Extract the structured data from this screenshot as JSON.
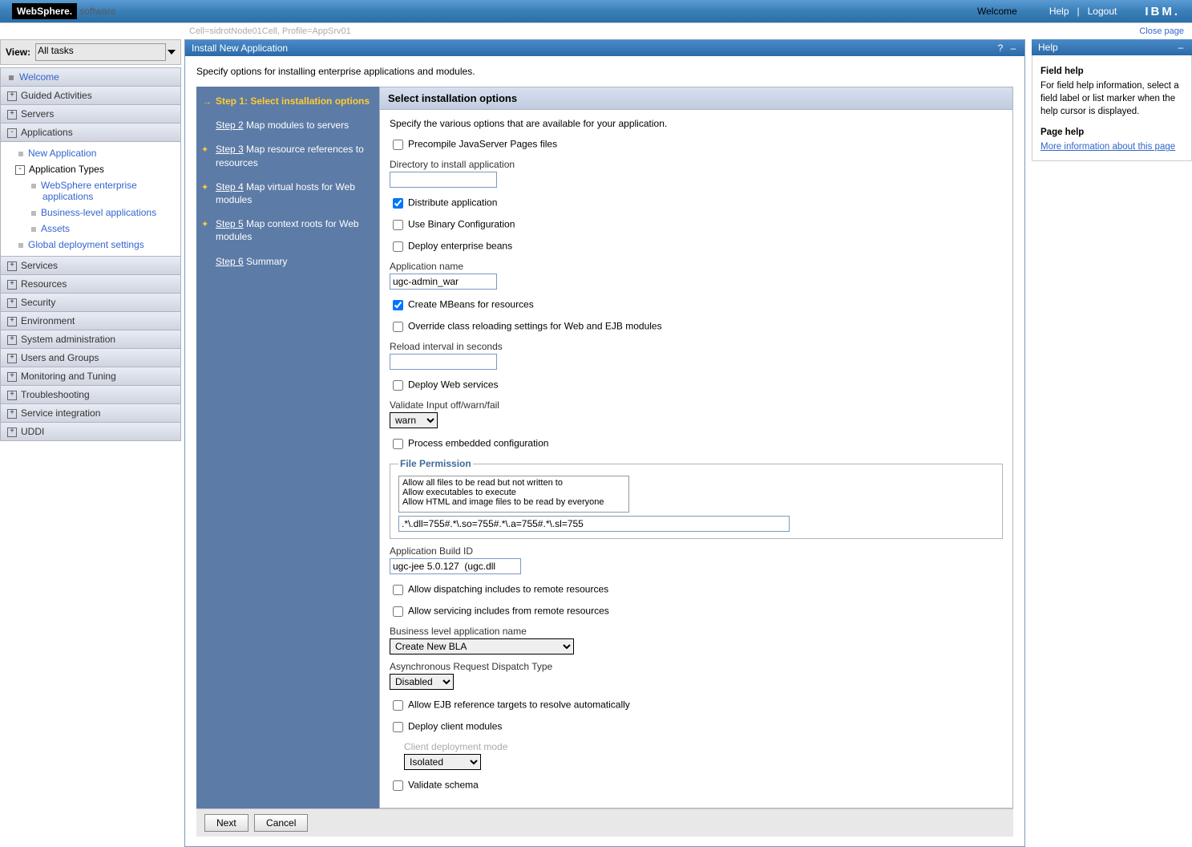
{
  "header": {
    "logo_main": "WebSphere.",
    "logo_sub": "software",
    "welcome": "Welcome",
    "help": "Help",
    "logout": "Logout",
    "ibm": "IBM.",
    "cell_info": "Cell=sidrotNode01Cell, Profile=AppSrv01",
    "close": "Close page"
  },
  "sidebar": {
    "view_label": "View:",
    "view_value": "All tasks",
    "welcome": "Welcome",
    "guided": "Guided Activities",
    "servers": "Servers",
    "applications": "Applications",
    "new_app": "New Application",
    "app_types": "Application Types",
    "ws_apps": "WebSphere enterprise applications",
    "biz_apps": "Business-level applications",
    "assets": "Assets",
    "global": "Global deployment settings",
    "services": "Services",
    "resources": "Resources",
    "security": "Security",
    "environment": "Environment",
    "sysadmin": "System administration",
    "users": "Users and Groups",
    "monitoring": "Monitoring and Tuning",
    "trouble": "Troubleshooting",
    "svcint": "Service integration",
    "uddi": "UDDI"
  },
  "panel": {
    "title": "Install New Application",
    "desc": "Specify options for installing enterprise applications and modules."
  },
  "steps": {
    "s1": "Step 1: Select installation options",
    "s2": "Step 2",
    "s2d": "  Map modules to servers",
    "s3": "Step 3",
    "s3d": "  Map resource references to resources",
    "s4": "Step 4",
    "s4d": "  Map virtual hosts for Web modules",
    "s5": "Step 5",
    "s5d": "  Map context roots for Web modules",
    "s6": "Step 6",
    "s6d": "  Summary"
  },
  "form": {
    "heading": "Select installation options",
    "sub": "Specify the various options that are available for your application.",
    "precompile": "Precompile JavaServer Pages files",
    "dir_label": "Directory to install application",
    "dir_value": "",
    "distribute": "Distribute application",
    "usebinary": "Use Binary Configuration",
    "deployejb": "Deploy enterprise beans",
    "appname_label": "Application name",
    "appname_value": "ugc-admin_war",
    "mbeans": "Create MBeans for resources",
    "override": "Override class reloading settings for Web and EJB modules",
    "reload_label": "Reload interval in seconds",
    "reload_value": "",
    "deployws": "Deploy Web services",
    "validate_label": "Validate Input off/warn/fail",
    "validate_value": "warn",
    "processembed": "Process embedded configuration",
    "fileperm_legend": "File Permission",
    "fp1": "Allow all files to be read but not written to",
    "fp2": "Allow executables to execute",
    "fp3": "Allow HTML and image files to be read by everyone",
    "fp_value": ".*\\.dll=755#.*\\.so=755#.*\\.a=755#.*\\.sl=755",
    "buildid_label": "Application Build ID",
    "buildid_value": "ugc-jee 5.0.127  (ugc.dll",
    "dispatch": "Allow dispatching includes to remote resources",
    "servicing": "Allow servicing includes from remote resources",
    "bla_label": "Business level application name",
    "bla_value": "Create New BLA",
    "async_label": "Asynchronous Request Dispatch Type",
    "async_value": "Disabled",
    "ejbref": "Allow EJB reference targets to resolve automatically",
    "deployclient": "Deploy client modules",
    "clientmode_label": "Client deployment mode",
    "clientmode_value": "Isolated",
    "validateschema": "Validate schema"
  },
  "buttons": {
    "next": "Next",
    "cancel": "Cancel"
  },
  "help": {
    "title": "Help",
    "fh_title": "Field help",
    "fh_body": "For field help information, select a field label or list marker when the help cursor is displayed.",
    "ph_title": "Page help",
    "ph_link": "More information about this page"
  }
}
